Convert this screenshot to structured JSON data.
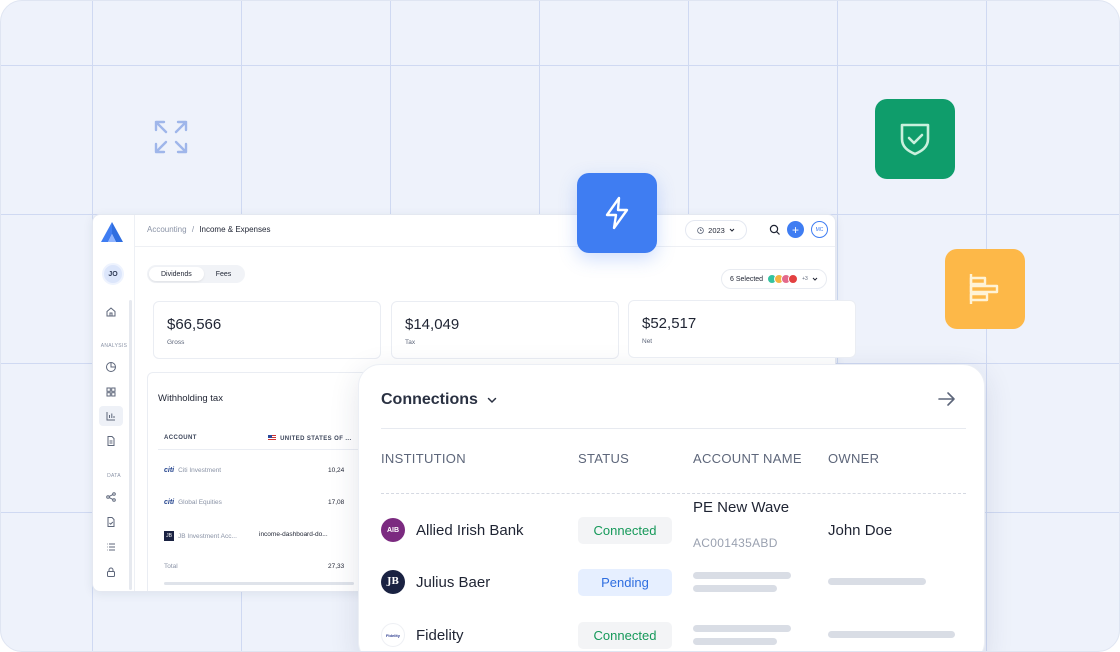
{
  "app": {
    "breadcrumb": {
      "parent": "Accounting",
      "separator": "/",
      "current": "Income & Expenses"
    },
    "year": "2023",
    "user_initials": "JO",
    "header_avatar": "MC",
    "sidebar": {
      "section_analysis": "ANALYSIS",
      "section_data": "DATA",
      "icons": [
        "home-icon",
        "pie-chart-icon",
        "grid-icon",
        "bar-chart-icon",
        "document-icon",
        "share-icon",
        "file-check-icon",
        "list-icon",
        "lock-icon"
      ]
    },
    "tabs": [
      "Dividends",
      "Fees"
    ],
    "selected_label": "6 Selected",
    "selected_more": "+3",
    "stats": [
      {
        "value": "$66,566",
        "label": "Gross"
      },
      {
        "value": "$14,049",
        "label": "Tax"
      },
      {
        "value": "$52,517",
        "label": "Net"
      }
    ],
    "withholding": {
      "title": "Withholding tax",
      "col_account": "ACCOUNT",
      "col_country": "UNITED STATES OF ...",
      "rows": [
        {
          "name": "Citi Investment",
          "value": "10,24"
        },
        {
          "name": "Global Equities",
          "value": "17,08"
        },
        {
          "name": "JB Investment Acc...",
          "link": "income-dashboard-do..."
        },
        {
          "name": "Total",
          "value": "27,33"
        }
      ]
    }
  },
  "connections": {
    "title": "Connections",
    "columns": [
      "INSTITUTION",
      "STATUS",
      "ACCOUNT NAME",
      "OWNER"
    ],
    "rows": [
      {
        "institution": "Allied Irish Bank",
        "logo": "AIB",
        "status": "Connected",
        "account_name": "PE New Wave",
        "account_number": "AC001435ABD",
        "owner": "John Doe"
      },
      {
        "institution": "Julius Baer",
        "logo": "JB",
        "status": "Pending"
      },
      {
        "institution": "Fidelity",
        "logo": "Fidelity",
        "status": "Connected"
      }
    ]
  },
  "colors": {
    "accent_blue": "#3f7df2",
    "green_tile": "#0f9d6b",
    "orange_tile": "#fdb848",
    "connected_text": "#16995a",
    "pending_text": "#2f6ee0"
  }
}
